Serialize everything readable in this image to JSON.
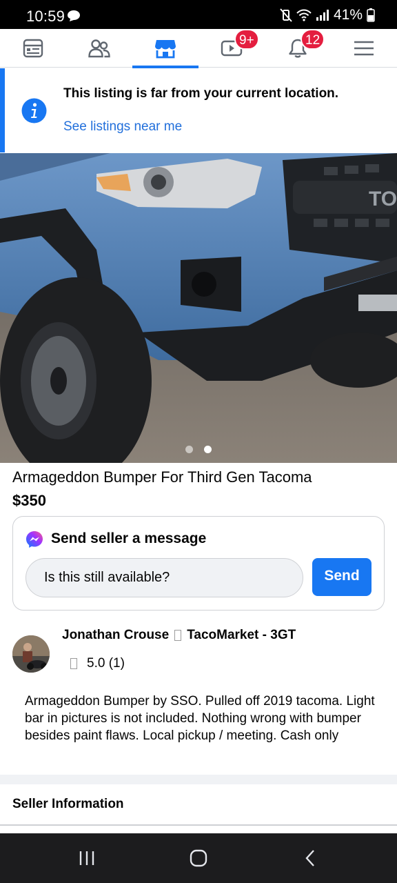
{
  "status_bar": {
    "time": "10:59",
    "battery_percent": "41%",
    "icons": [
      "chat-bubble-icon",
      "mute-vibrate-icon",
      "wifi-icon",
      "signal-icon",
      "battery-icon"
    ]
  },
  "nav_bar": {
    "items": [
      {
        "name": "feed",
        "icon": "feed-icon"
      },
      {
        "name": "friends",
        "icon": "friends-icon"
      },
      {
        "name": "marketplace",
        "icon": "marketplace-store-icon",
        "active": true
      },
      {
        "name": "watch",
        "icon": "video-icon",
        "badge": "9+"
      },
      {
        "name": "notifications",
        "icon": "bell-icon",
        "badge": "12"
      },
      {
        "name": "menu",
        "icon": "hamburger-menu-icon"
      }
    ],
    "accent_color": "#1877f2",
    "badge_color": "#e41e3f"
  },
  "location_banner": {
    "title": "This listing is far from your current location.",
    "link": "See listings near me",
    "icon": "info-icon"
  },
  "photo": {
    "slide_count": 2,
    "active_slide": 2
  },
  "listing": {
    "title": "Armageddon Bumper For Third Gen Tacoma",
    "price": "$350"
  },
  "message_card": {
    "header": "Send seller a message",
    "icon": "messenger-icon",
    "input_value": "Is this still available?",
    "send_label": "Send"
  },
  "seller": {
    "name": "Jonathan Crouse",
    "group": "TacoMarket - 3GT",
    "rating": "5.0 (1)"
  },
  "description": "Armageddon Bumper by SSO. Pulled off 2019 tacoma. Light bar in pictures is not included. Nothing wrong with bumper besides paint flaws.  Local pickup / meeting.  Cash only",
  "seller_information_label": "Seller Information",
  "system_nav": {
    "buttons": [
      "recents-icon",
      "home-icon",
      "back-icon"
    ]
  }
}
